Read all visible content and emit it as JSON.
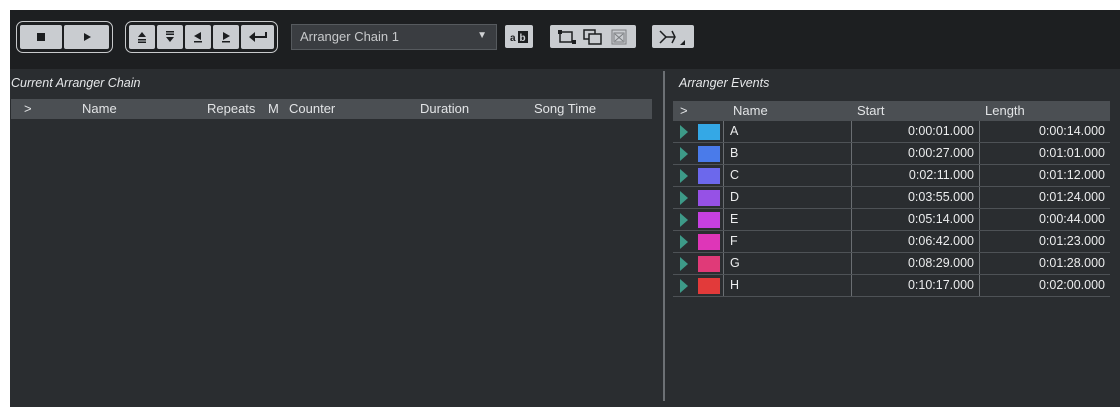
{
  "toolbar": {
    "transport": {
      "stop": "stop",
      "play": "play"
    },
    "nav_icons": [
      "move-up-icon",
      "move-down-icon",
      "jump-first-icon",
      "jump-last-icon",
      "return-icon"
    ],
    "chain_select": {
      "value": "Arranger Chain 1",
      "arrow": "▼"
    },
    "rename_icon": "rename-ab-icon",
    "chain_icons": [
      "new-chain-icon",
      "duplicate-chain-icon",
      "remove-chain-icon"
    ],
    "flatten_icon": "flatten-chain-icon"
  },
  "left_panel": {
    "title": "Current Arranger Chain",
    "columns": [
      ">",
      "",
      "Name",
      "Repeats",
      "M",
      "Counter",
      "Duration",
      "Song Time"
    ]
  },
  "right_panel": {
    "title": "Arranger Events",
    "columns": [
      ">",
      "",
      "Name",
      "Start",
      "Length"
    ],
    "events": [
      {
        "name": "A",
        "start": "0:00:01.000",
        "length": "0:00:14.000",
        "color": "#34a8e6"
      },
      {
        "name": "B",
        "start": "0:00:27.000",
        "length": "0:01:01.000",
        "color": "#4a7bea"
      },
      {
        "name": "C",
        "start": "0:02:11.000",
        "length": "0:01:12.000",
        "color": "#6c68ec"
      },
      {
        "name": "D",
        "start": "0:03:55.000",
        "length": "0:01:24.000",
        "color": "#9651e6"
      },
      {
        "name": "E",
        "start": "0:05:14.000",
        "length": "0:00:44.000",
        "color": "#c540e0"
      },
      {
        "name": "F",
        "start": "0:06:42.000",
        "length": "0:01:23.000",
        "color": "#de36b8"
      },
      {
        "name": "G",
        "start": "0:08:29.000",
        "length": "0:01:28.000",
        "color": "#e03a78"
      },
      {
        "name": "H",
        "start": "0:10:17.000",
        "length": "0:02:00.000",
        "color": "#e23a3a"
      }
    ]
  },
  "colors": {
    "background": "#2a2d30",
    "toolbar": "#1d1f21",
    "header": "#4b4f53",
    "play_marker": "#3d9a88"
  }
}
